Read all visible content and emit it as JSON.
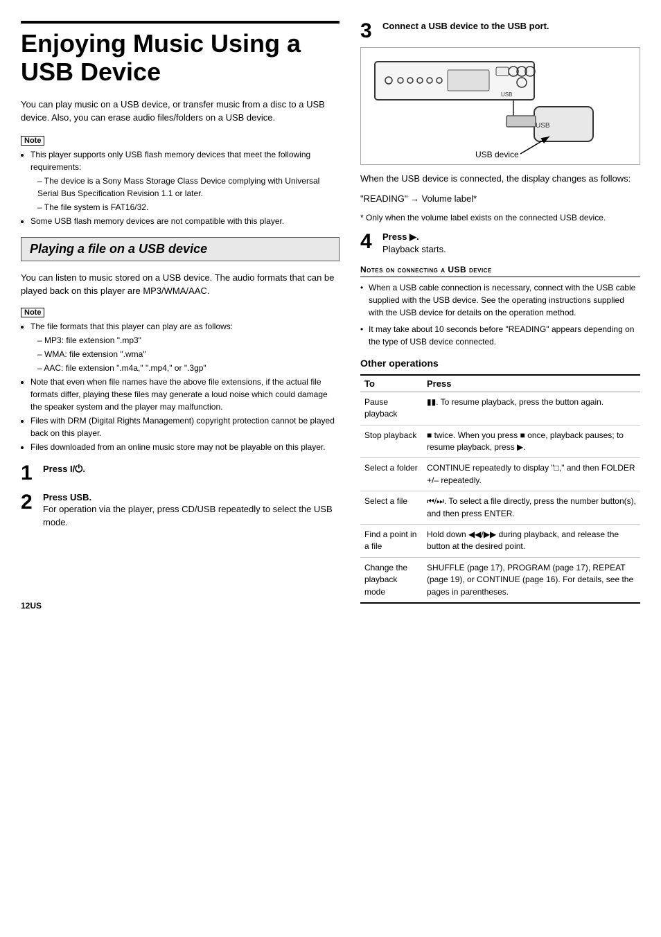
{
  "page": {
    "number": "12US"
  },
  "main_title": "Enjoying Music Using a USB Device",
  "intro": "You can play music on a USB device, or transfer music from a disc to a USB device. Also, you can erase audio files/folders on a USB device.",
  "note1": {
    "label": "Note",
    "bullets": [
      "This player supports only USB flash memory devices that meet the following requirements:",
      "sub:The device is a Sony Mass Storage Class Device complying with Universal Serial Bus Specification Revision 1.1 or later.",
      "sub:The file system is FAT16/32.",
      "Some USB flash memory devices are not compatible with this player."
    ]
  },
  "section_title": "Playing a file on a USB device",
  "section_intro": "You can listen to music stored on a USB device. The audio formats that can be played back on this player are MP3/WMA/AAC.",
  "note2": {
    "label": "Note",
    "bullets": [
      "The file formats that this player can play are as follows:",
      "sub:MP3: file extension \".mp3\"",
      "sub:WMA: file extension \".wma\"",
      "sub:AAC: file extension \".m4a,\" \".mp4,\" or \".3gp\"",
      "Note that even when file names have the above file extensions, if the actual file formats differ, playing these files may generate a loud noise which could damage the speaker system and the player may malfunction.",
      "Files with DRM (Digital Rights Management) copyright protection cannot be played back on this player.",
      "Files downloaded from an online music store may not be playable on this player."
    ]
  },
  "step1": {
    "number": "1",
    "label": "Press I/⏻.",
    "desc": ""
  },
  "step2": {
    "number": "2",
    "label": "Press USB.",
    "desc": "For operation via the player, press CD/USB repeatedly to select the USB mode."
  },
  "step3": {
    "number": "3",
    "label": "Connect a USB device to the USB port.",
    "usb_device_label": "USB device",
    "usb_text_label": "USB",
    "display_text1": "When the USB device is connected, the display changes as follows:",
    "display_text2": "\"READING\" → Volume label*",
    "asterisk": "* Only when the volume label exists on the connected USB device."
  },
  "step4": {
    "number": "4",
    "label": "Press ▶.",
    "desc": "Playback starts."
  },
  "notes_connecting": {
    "title": "Notes on connecting a USB device",
    "items": [
      "When a USB cable connection is necessary, connect with the USB cable supplied with the USB device. See the operating instructions supplied with the USB device for details on the operation method.",
      "It may take about 10 seconds before \"READING\" appears depending on the type of USB device connected."
    ]
  },
  "other_ops": {
    "title": "Other operations",
    "col1": "To",
    "col2": "Press",
    "rows": [
      {
        "to": "Pause playback",
        "press": "⏸. To resume playback, press the button again."
      },
      {
        "to": "Stop playback",
        "press": "■ twice. When you press ■ once, playback pauses; to resume playback, press ▶."
      },
      {
        "to": "Select a folder",
        "press": "CONTINUE repeatedly to display \"□,\" and then FOLDER +/– repeatedly."
      },
      {
        "to": "Select a file",
        "press": "⏮/⏭. To select a file directly, press the number button(s), and then press ENTER."
      },
      {
        "to": "Find a point in a file",
        "press": "Hold down ◀◀/▶▶ during playback, and release the button at the desired point."
      },
      {
        "to": "Change the playback mode",
        "press": "SHUFFLE (page 17), PROGRAM (page 17), REPEAT (page 19), or CONTINUE (page 16). For details, see the pages in parentheses."
      }
    ]
  }
}
